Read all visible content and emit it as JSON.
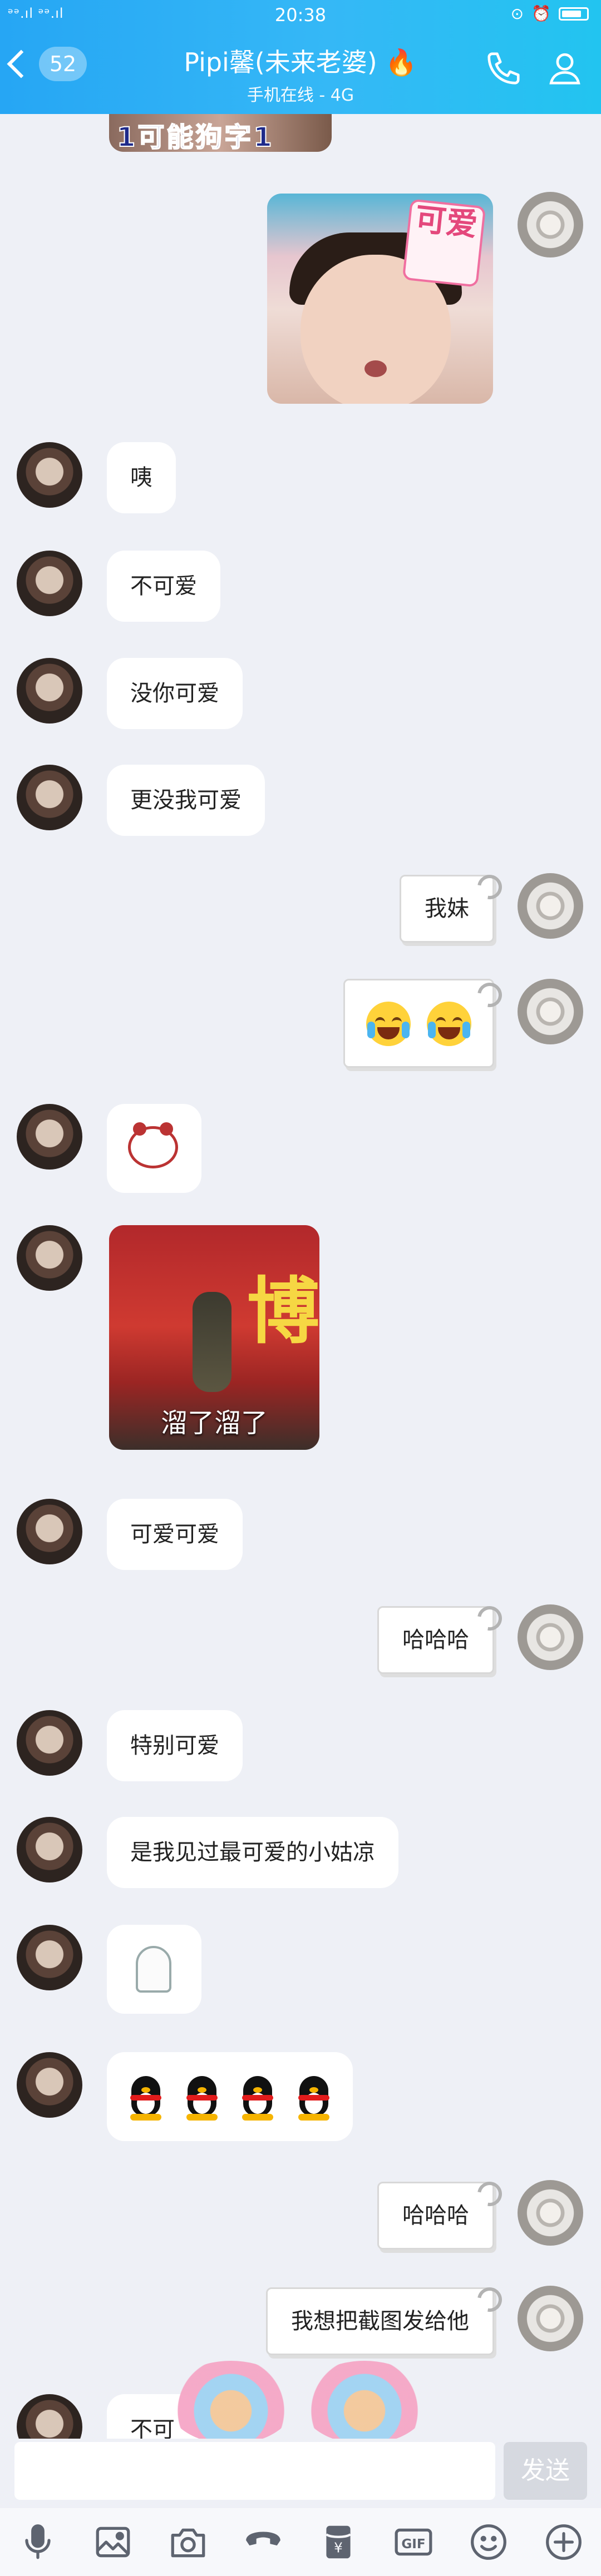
{
  "status_bar": {
    "signal_text": "ᵊᵊ.ıl ᵊᵊ.ıl",
    "time": "20:38"
  },
  "header": {
    "back_badge": "52",
    "title": "Pipi馨(未来老婆)",
    "subtitle": "手机在线 - 4G"
  },
  "images": {
    "top_crop_text": "1可能狗字1",
    "selfie_sticker": "可爱",
    "run_big_char": "博",
    "run_caption": "溜了溜了"
  },
  "messages": [
    {
      "side": "left",
      "text": "咦"
    },
    {
      "side": "left",
      "text": "不可爱"
    },
    {
      "side": "left",
      "text": "没你可爱"
    },
    {
      "side": "left",
      "text": "更没我可爱"
    },
    {
      "side": "right",
      "text": "我妹"
    },
    {
      "side": "left",
      "text": "可爱可爱"
    },
    {
      "side": "right",
      "text": "哈哈哈"
    },
    {
      "side": "left",
      "text": "特别可爱"
    },
    {
      "side": "left",
      "text": "是我见过最可爱的小姑凉"
    },
    {
      "side": "right",
      "text": "哈哈哈"
    },
    {
      "side": "right",
      "text": "我想把截图发给他"
    },
    {
      "side": "left",
      "text": "不可"
    }
  ],
  "input": {
    "value": "",
    "send_label": "发送"
  },
  "toolbar": {
    "icons": [
      "microphone-icon",
      "image-icon",
      "camera-icon",
      "voice-call-icon",
      "red-packet-icon",
      "gif-icon",
      "emoji-icon",
      "plus-icon"
    ],
    "gif_label": "GIF",
    "red_packet_label": "¥"
  },
  "colors": {
    "header_blue": "#26a6f4",
    "chat_bg": "#eef0f6",
    "send_disabled": "#d6d9e0"
  }
}
